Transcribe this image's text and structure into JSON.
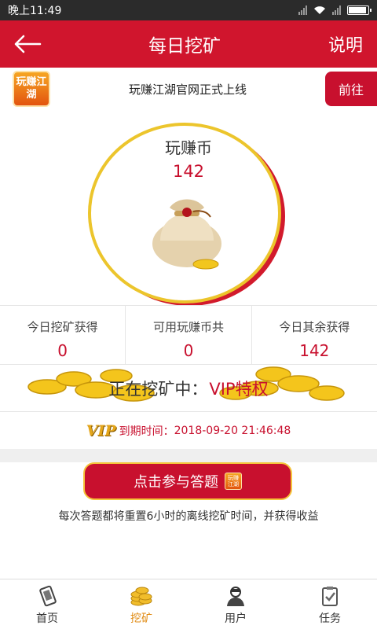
{
  "status_bar": {
    "time": "晚上11:49"
  },
  "app_bar": {
    "back_icon": "back-arrow-icon",
    "title": "每日挖矿",
    "help_label": "说明"
  },
  "notice": {
    "logo_text": "玩赚江湖",
    "text": "玩赚江湖官网正式上线",
    "goto_label": "前往"
  },
  "coins": {
    "label": "玩赚币",
    "value": "142"
  },
  "stats": [
    {
      "label": "今日挖矿获得",
      "value": "0"
    },
    {
      "label": "可用玩赚币共",
      "value": "0"
    },
    {
      "label": "今日其余获得",
      "value": "142"
    }
  ],
  "mining": {
    "prefix": "正在挖矿中：",
    "status": "VIP特权"
  },
  "expiry": {
    "vip_logo": "VIP",
    "label": "到期时间：",
    "datetime": "2018-09-20 21:46:48"
  },
  "quiz": {
    "button_label": "点击参与答题",
    "logo_text": "玩赚江湖",
    "description": "每次答题都将重置6小时的离线挖矿时间，并获得收益"
  },
  "tabs": [
    {
      "label": "首页",
      "icon": "home-phone-icon"
    },
    {
      "label": "挖矿",
      "icon": "coin-stack-icon",
      "active": true
    },
    {
      "label": "用户",
      "icon": "user-icon"
    },
    {
      "label": "任务",
      "icon": "task-clipboard-icon"
    }
  ],
  "colors": {
    "primary_red": "#d0152d",
    "gold": "#ecc52c",
    "active_tab": "#e08a12"
  }
}
